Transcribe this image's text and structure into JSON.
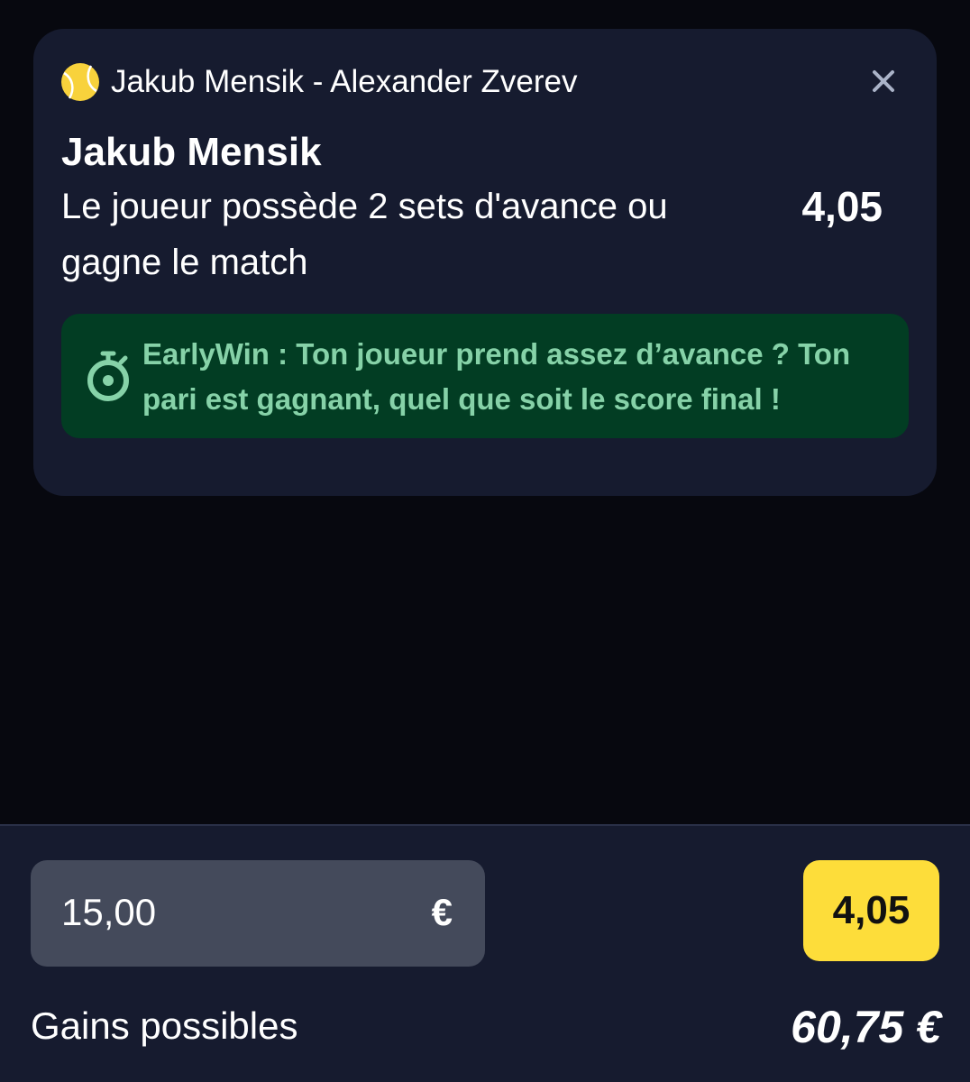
{
  "bet_card": {
    "match_title": "Jakub Mensik - Alexander Zverev",
    "sport_icon": "tennis-ball-icon",
    "close_icon": "close-icon",
    "selection_name": "Jakub Mensik",
    "market_name": "Le joueur possède 2 sets d'avance ou gagne le match",
    "odds": "4,05",
    "earlywin": {
      "icon": "stopwatch-icon",
      "text": "EarlyWin : Ton joueur prend assez d’avance ? Ton pari est gagnant, quel que soit le score final !"
    }
  },
  "stake_panel": {
    "stake_value": "15,00",
    "currency": "€",
    "odds_button_label": "4,05",
    "gains_label": "Gains possibles",
    "gains_value": "60,75 €"
  },
  "colors": {
    "background": "#07080f",
    "card": "#161b2f",
    "earlywin_bg": "#023d23",
    "earlywin_text": "#86d2a8",
    "stake_input_bg": "#444a5b",
    "odds_button_bg": "#fddd3a",
    "tennis_ball": "#f8d23c"
  }
}
